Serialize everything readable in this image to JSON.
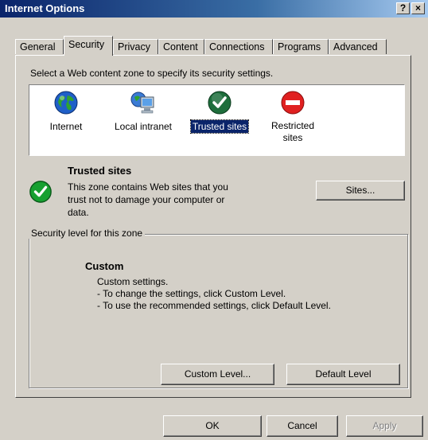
{
  "window": {
    "title": "Internet Options",
    "help_label": "?",
    "close_label": "×"
  },
  "tabs": [
    {
      "label": "General"
    },
    {
      "label": "Security"
    },
    {
      "label": "Privacy"
    },
    {
      "label": "Content"
    },
    {
      "label": "Connections"
    },
    {
      "label": "Programs"
    },
    {
      "label": "Advanced"
    }
  ],
  "instructions": "Select a Web content zone to specify its security settings.",
  "zones": [
    {
      "label": "Internet",
      "icon": "globe-icon"
    },
    {
      "label": "Local intranet",
      "icon": "intranet-icon"
    },
    {
      "label": "Trusted sites",
      "icon": "check-icon"
    },
    {
      "label_line1": "Restricted",
      "label_line2": "sites",
      "icon": "restricted-icon"
    }
  ],
  "selected_zone": {
    "title": "Trusted sites",
    "desc_line1": "This zone contains Web sites that you",
    "desc_line2": "trust not to damage your computer or",
    "desc_line3": "data.",
    "sites_button": "Sites..."
  },
  "security_level": {
    "group_label": "Security level for this zone",
    "level_title": "Custom",
    "line1": "Custom settings.",
    "line2": "- To change the settings, click Custom Level.",
    "line3": "- To use the recommended settings, click Default Level.",
    "custom_button": "Custom Level...",
    "default_button": "Default Level"
  },
  "footer": {
    "ok": "OK",
    "cancel": "Cancel",
    "apply": "Apply"
  },
  "colors": {
    "title_bar": "#0a246a",
    "dialog_bg": "#d4d0c8",
    "selection": "#0a246a"
  }
}
